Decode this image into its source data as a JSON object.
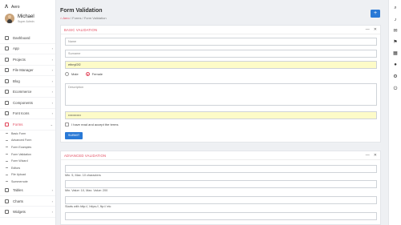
{
  "brand": {
    "name": "Aero"
  },
  "user": {
    "name": "Michael",
    "role": "Super Admin"
  },
  "sidebar": {
    "items": [
      {
        "label": "Dashboard",
        "chev": ""
      },
      {
        "label": "App",
        "chev": "›"
      },
      {
        "label": "Projects",
        "chev": "›"
      },
      {
        "label": "File Manager",
        "chev": "›"
      },
      {
        "label": "Blog",
        "chev": "›"
      },
      {
        "label": "Ecommerce",
        "chev": "›"
      },
      {
        "label": "Components",
        "chev": "›"
      },
      {
        "label": "Font Icons",
        "chev": "›"
      },
      {
        "label": "Forms",
        "chev": "⌄"
      }
    ],
    "forms_sub": [
      "Basic Form",
      "Advanced Form",
      "Form Examples",
      "Form Validation",
      "Form Wizard",
      "Editors",
      "File Upload",
      "Summernote"
    ],
    "items_after": [
      {
        "label": "Tables",
        "chev": "›"
      },
      {
        "label": "Charts",
        "chev": "›"
      },
      {
        "label": "Widgets",
        "chev": "›"
      }
    ]
  },
  "header": {
    "title": "Form Validation",
    "crumb_home": "Aero",
    "crumb_1": "Forms",
    "crumb_2": "Form Validation",
    "sep": "/",
    "fab": "+"
  },
  "basic": {
    "title": "BASIC VALIDATION",
    "ctl_min": "—",
    "ctl_close": "✕",
    "name_ph": "Name",
    "surname_ph": "Surname",
    "email_val": "ethnyf2f2",
    "male": "Male",
    "female": "Female",
    "description_ph": "Description",
    "password_val": "••••••••••••",
    "terms": "I have read and accept the terms",
    "submit": "SUBMIT"
  },
  "advanced": {
    "title": "ADVANCED VALIDATION",
    "ctl_min": "—",
    "ctl_close": "✕",
    "hint1": "Min. 5, Max. 10 characters",
    "hint2": "Min. Value: 10, Max. Value: 200",
    "hint3": "Starts with http://, https://, ftp:// etc"
  },
  "rail_icons": [
    "search-icon",
    "bell-icon",
    "mail-icon",
    "flag-icon",
    "calendar-icon",
    "user-icon",
    "gear-icon",
    "power-icon"
  ]
}
